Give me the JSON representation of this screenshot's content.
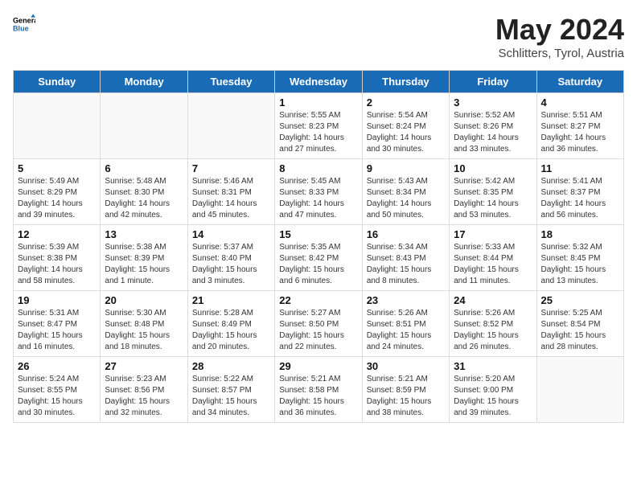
{
  "header": {
    "logo_general": "General",
    "logo_blue": "Blue",
    "month_title": "May 2024",
    "location": "Schlitters, Tyrol, Austria"
  },
  "days_of_week": [
    "Sunday",
    "Monday",
    "Tuesday",
    "Wednesday",
    "Thursday",
    "Friday",
    "Saturday"
  ],
  "weeks": [
    [
      {
        "day": "",
        "info": "",
        "empty": true
      },
      {
        "day": "",
        "info": "",
        "empty": true
      },
      {
        "day": "",
        "info": "",
        "empty": true
      },
      {
        "day": "1",
        "info": "Sunrise: 5:55 AM\nSunset: 8:23 PM\nDaylight: 14 hours and 27 minutes."
      },
      {
        "day": "2",
        "info": "Sunrise: 5:54 AM\nSunset: 8:24 PM\nDaylight: 14 hours and 30 minutes."
      },
      {
        "day": "3",
        "info": "Sunrise: 5:52 AM\nSunset: 8:26 PM\nDaylight: 14 hours and 33 minutes."
      },
      {
        "day": "4",
        "info": "Sunrise: 5:51 AM\nSunset: 8:27 PM\nDaylight: 14 hours and 36 minutes."
      }
    ],
    [
      {
        "day": "5",
        "info": "Sunrise: 5:49 AM\nSunset: 8:29 PM\nDaylight: 14 hours and 39 minutes."
      },
      {
        "day": "6",
        "info": "Sunrise: 5:48 AM\nSunset: 8:30 PM\nDaylight: 14 hours and 42 minutes."
      },
      {
        "day": "7",
        "info": "Sunrise: 5:46 AM\nSunset: 8:31 PM\nDaylight: 14 hours and 45 minutes."
      },
      {
        "day": "8",
        "info": "Sunrise: 5:45 AM\nSunset: 8:33 PM\nDaylight: 14 hours and 47 minutes."
      },
      {
        "day": "9",
        "info": "Sunrise: 5:43 AM\nSunset: 8:34 PM\nDaylight: 14 hours and 50 minutes."
      },
      {
        "day": "10",
        "info": "Sunrise: 5:42 AM\nSunset: 8:35 PM\nDaylight: 14 hours and 53 minutes."
      },
      {
        "day": "11",
        "info": "Sunrise: 5:41 AM\nSunset: 8:37 PM\nDaylight: 14 hours and 56 minutes."
      }
    ],
    [
      {
        "day": "12",
        "info": "Sunrise: 5:39 AM\nSunset: 8:38 PM\nDaylight: 14 hours and 58 minutes."
      },
      {
        "day": "13",
        "info": "Sunrise: 5:38 AM\nSunset: 8:39 PM\nDaylight: 15 hours and 1 minute."
      },
      {
        "day": "14",
        "info": "Sunrise: 5:37 AM\nSunset: 8:40 PM\nDaylight: 15 hours and 3 minutes."
      },
      {
        "day": "15",
        "info": "Sunrise: 5:35 AM\nSunset: 8:42 PM\nDaylight: 15 hours and 6 minutes."
      },
      {
        "day": "16",
        "info": "Sunrise: 5:34 AM\nSunset: 8:43 PM\nDaylight: 15 hours and 8 minutes."
      },
      {
        "day": "17",
        "info": "Sunrise: 5:33 AM\nSunset: 8:44 PM\nDaylight: 15 hours and 11 minutes."
      },
      {
        "day": "18",
        "info": "Sunrise: 5:32 AM\nSunset: 8:45 PM\nDaylight: 15 hours and 13 minutes."
      }
    ],
    [
      {
        "day": "19",
        "info": "Sunrise: 5:31 AM\nSunset: 8:47 PM\nDaylight: 15 hours and 16 minutes."
      },
      {
        "day": "20",
        "info": "Sunrise: 5:30 AM\nSunset: 8:48 PM\nDaylight: 15 hours and 18 minutes."
      },
      {
        "day": "21",
        "info": "Sunrise: 5:28 AM\nSunset: 8:49 PM\nDaylight: 15 hours and 20 minutes."
      },
      {
        "day": "22",
        "info": "Sunrise: 5:27 AM\nSunset: 8:50 PM\nDaylight: 15 hours and 22 minutes."
      },
      {
        "day": "23",
        "info": "Sunrise: 5:26 AM\nSunset: 8:51 PM\nDaylight: 15 hours and 24 minutes."
      },
      {
        "day": "24",
        "info": "Sunrise: 5:26 AM\nSunset: 8:52 PM\nDaylight: 15 hours and 26 minutes."
      },
      {
        "day": "25",
        "info": "Sunrise: 5:25 AM\nSunset: 8:54 PM\nDaylight: 15 hours and 28 minutes."
      }
    ],
    [
      {
        "day": "26",
        "info": "Sunrise: 5:24 AM\nSunset: 8:55 PM\nDaylight: 15 hours and 30 minutes."
      },
      {
        "day": "27",
        "info": "Sunrise: 5:23 AM\nSunset: 8:56 PM\nDaylight: 15 hours and 32 minutes."
      },
      {
        "day": "28",
        "info": "Sunrise: 5:22 AM\nSunset: 8:57 PM\nDaylight: 15 hours and 34 minutes."
      },
      {
        "day": "29",
        "info": "Sunrise: 5:21 AM\nSunset: 8:58 PM\nDaylight: 15 hours and 36 minutes."
      },
      {
        "day": "30",
        "info": "Sunrise: 5:21 AM\nSunset: 8:59 PM\nDaylight: 15 hours and 38 minutes."
      },
      {
        "day": "31",
        "info": "Sunrise: 5:20 AM\nSunset: 9:00 PM\nDaylight: 15 hours and 39 minutes."
      },
      {
        "day": "",
        "info": "",
        "empty": true
      }
    ]
  ]
}
